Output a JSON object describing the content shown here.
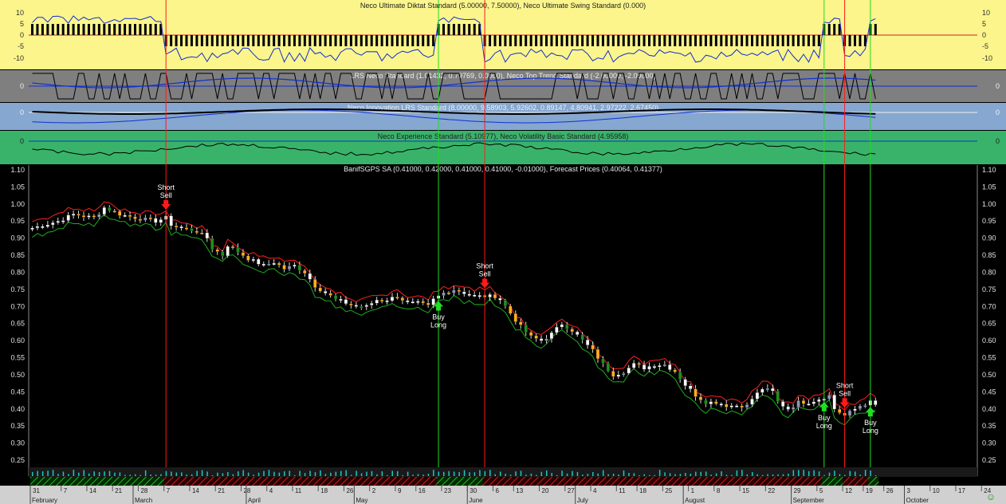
{
  "colors": {
    "panel1_bg": "#fbf58c",
    "panel2_bg": "#7f7f7f",
    "panel3_bg": "#86a7cf",
    "panel4_bg": "#39b36a",
    "main_bg": "#000000",
    "axis_bg": "#d0d0d0",
    "sell_line": "#ff1a1a",
    "buy_line": "#22dd22",
    "up_candle": "#ffffff",
    "down_candle": "#ffb020",
    "neutral_candle": "#8e98b8",
    "upper_band": "#ff2020",
    "lower_band": "#1faa1f",
    "volume": "#19c8c8"
  },
  "panels": [
    {
      "title": "Neco Ultimate Diktat Standard (5.00000, 7.50000), Neco Ultimate Swing Standard (0.000)",
      "ticks": [
        "10",
        "5",
        "0",
        "-5",
        "-10"
      ]
    },
    {
      "title": "LRS Neco Standard (1.01432, 0.79769, 0.0000), Neco Top Trend Standard (-2.00000, -2.00000)",
      "ticks": [
        "0"
      ]
    },
    {
      "title": "Neco Innovation LRS Standard (8.00000, 9.58903, 5.92602, 0.89147, 4.80941, 2.97222, 2.67450)",
      "ticks": [
        "0"
      ]
    },
    {
      "title": "Neco Experience Standard (5.10977), Neco Volatility Basic Standard (4.95958)",
      "ticks": [
        "0"
      ]
    }
  ],
  "chart_data": {
    "type": "candlestick",
    "title": "BanifSGPS SA (0.41000, 0.42000, 0.41000, 0.41000, -0.01000), Forecast Prices (0.40064, 0.41377)",
    "y_ticks": [
      "1.10",
      "1.05",
      "1.00",
      "0.95",
      "0.90",
      "0.85",
      "0.80",
      "0.75",
      "0.70",
      "0.65",
      "0.60",
      "0.55",
      "0.50",
      "0.45",
      "0.40",
      "0.35",
      "0.30",
      "0.25"
    ],
    "ylim": [
      0.22,
      1.11
    ],
    "close_path": [
      [
        0,
        0.93
      ],
      [
        5,
        0.95
      ],
      [
        8,
        0.97
      ],
      [
        12,
        0.96
      ],
      [
        14,
        0.99
      ],
      [
        17,
        0.97
      ],
      [
        20,
        0.96
      ],
      [
        24,
        0.95
      ],
      [
        26,
        0.96
      ],
      [
        27,
        0.94
      ],
      [
        29,
        0.93
      ],
      [
        32,
        0.92
      ],
      [
        34,
        0.9
      ],
      [
        35,
        0.87
      ],
      [
        37,
        0.85
      ],
      [
        38,
        0.88
      ],
      [
        40,
        0.86
      ],
      [
        42,
        0.84
      ],
      [
        45,
        0.82
      ],
      [
        47,
        0.83
      ],
      [
        49,
        0.81
      ],
      [
        51,
        0.82
      ],
      [
        53,
        0.8
      ],
      [
        55,
        0.76
      ],
      [
        57,
        0.74
      ],
      [
        59,
        0.72
      ],
      [
        61,
        0.71
      ],
      [
        63,
        0.7
      ],
      [
        65,
        0.7
      ],
      [
        67,
        0.72
      ],
      [
        69,
        0.72
      ],
      [
        71,
        0.73
      ],
      [
        73,
        0.71
      ],
      [
        75,
        0.71
      ],
      [
        77,
        0.7
      ],
      [
        78,
        0.72
      ],
      [
        80,
        0.74
      ],
      [
        82,
        0.75
      ],
      [
        84,
        0.74
      ],
      [
        86,
        0.73
      ],
      [
        88,
        0.73
      ],
      [
        90,
        0.73
      ],
      [
        91,
        0.72
      ],
      [
        93,
        0.68
      ],
      [
        95,
        0.64
      ],
      [
        97,
        0.61
      ],
      [
        99,
        0.6
      ],
      [
        101,
        0.62
      ],
      [
        103,
        0.65
      ],
      [
        105,
        0.63
      ],
      [
        107,
        0.6
      ],
      [
        109,
        0.57
      ],
      [
        111,
        0.53
      ],
      [
        113,
        0.5
      ],
      [
        115,
        0.51
      ],
      [
        117,
        0.53
      ],
      [
        119,
        0.52
      ],
      [
        121,
        0.53
      ],
      [
        123,
        0.53
      ],
      [
        125,
        0.51
      ],
      [
        127,
        0.47
      ],
      [
        129,
        0.44
      ],
      [
        131,
        0.42
      ],
      [
        133,
        0.42
      ],
      [
        135,
        0.41
      ],
      [
        137,
        0.41
      ],
      [
        139,
        0.41
      ],
      [
        140,
        0.43
      ],
      [
        142,
        0.46
      ],
      [
        144,
        0.45
      ],
      [
        145,
        0.42
      ],
      [
        147,
        0.4
      ],
      [
        149,
        0.42
      ],
      [
        151,
        0.42
      ],
      [
        153,
        0.43
      ],
      [
        155,
        0.44
      ],
      [
        156,
        0.4
      ],
      [
        158,
        0.38
      ],
      [
        159,
        0.39
      ],
      [
        161,
        0.41
      ],
      [
        163,
        0.42
      ],
      [
        164,
        0.41
      ]
    ],
    "signals": [
      {
        "label1": "Short",
        "label2": "Sell",
        "type": "sell",
        "bar": 26
      },
      {
        "label1": "Buy",
        "label2": "Long",
        "type": "buy",
        "bar": 79
      },
      {
        "label1": "Short",
        "label2": "Sell",
        "type": "sell",
        "bar": 88
      },
      {
        "label1": "Buy",
        "label2": "Long",
        "type": "buy",
        "bar": 154
      },
      {
        "label1": "Short",
        "label2": "Sell",
        "type": "sell",
        "bar": 158
      },
      {
        "label1": "Buy",
        "label2": "Long",
        "type": "buy",
        "bar": 163
      }
    ],
    "bars_total": 165,
    "day_ticks": [
      {
        "label": "31",
        "bar": 0
      },
      {
        "label": "7",
        "bar": 6
      },
      {
        "label": "14",
        "bar": 11
      },
      {
        "label": "21",
        "bar": 16
      },
      {
        "label": "28",
        "bar": 21
      },
      {
        "label": "7",
        "bar": 26
      },
      {
        "label": "14",
        "bar": 31
      },
      {
        "label": "21",
        "bar": 36
      },
      {
        "label": "28",
        "bar": 41
      },
      {
        "label": "4",
        "bar": 46
      },
      {
        "label": "11",
        "bar": 51
      },
      {
        "label": "18",
        "bar": 56
      },
      {
        "label": "26",
        "bar": 61
      },
      {
        "label": "2",
        "bar": 66
      },
      {
        "label": "9",
        "bar": 71
      },
      {
        "label": "16",
        "bar": 75
      },
      {
        "label": "23",
        "bar": 80
      },
      {
        "label": "30",
        "bar": 85
      },
      {
        "label": "6",
        "bar": 90
      },
      {
        "label": "13",
        "bar": 94
      },
      {
        "label": "20",
        "bar": 99
      },
      {
        "label": "27",
        "bar": 104
      },
      {
        "label": "4",
        "bar": 109
      },
      {
        "label": "11",
        "bar": 114
      },
      {
        "label": "18",
        "bar": 118
      },
      {
        "label": "25",
        "bar": 123
      },
      {
        "label": "1",
        "bar": 128
      },
      {
        "label": "8",
        "bar": 133
      },
      {
        "label": "15",
        "bar": 138
      },
      {
        "label": "22",
        "bar": 143
      },
      {
        "label": "29",
        "bar": 148
      },
      {
        "label": "5",
        "bar": 153
      },
      {
        "label": "12",
        "bar": 158
      },
      {
        "label": "19",
        "bar": 162
      },
      {
        "label": "26",
        "bar": 166
      },
      {
        "label": "3",
        "bar": 170
      },
      {
        "label": "10",
        "bar": 175
      },
      {
        "label": "17",
        "bar": 180
      },
      {
        "label": "24",
        "bar": 185
      }
    ],
    "months": [
      {
        "label": "February",
        "bar": 0
      },
      {
        "label": "March",
        "bar": 20
      },
      {
        "label": "April",
        "bar": 42
      },
      {
        "label": "May",
        "bar": 63
      },
      {
        "label": "June",
        "bar": 85
      },
      {
        "label": "July",
        "bar": 106
      },
      {
        "label": "August",
        "bar": 127
      },
      {
        "label": "September",
        "bar": 148
      },
      {
        "label": "October",
        "bar": 170
      }
    ]
  }
}
